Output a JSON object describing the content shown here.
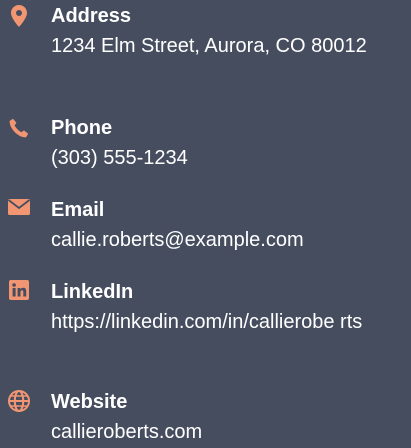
{
  "colors": {
    "background": "#464d5f",
    "accent": "#f29572",
    "text": "#ffffff"
  },
  "contact": {
    "items": [
      {
        "icon": "map-pin-icon",
        "label": "Address",
        "value": "1234 Elm Street, Aurora, CO 80012"
      },
      {
        "icon": "phone-icon",
        "label": "Phone",
        "value": "(303) 555-1234"
      },
      {
        "icon": "envelope-icon",
        "label": "Email",
        "value": "callie.roberts@example.com"
      },
      {
        "icon": "linkedin-icon",
        "label": "LinkedIn",
        "value": "https://linkedin.com/in/callierobe rts"
      },
      {
        "icon": "globe-icon",
        "label": "Website",
        "value": "callieroberts.com"
      }
    ]
  }
}
